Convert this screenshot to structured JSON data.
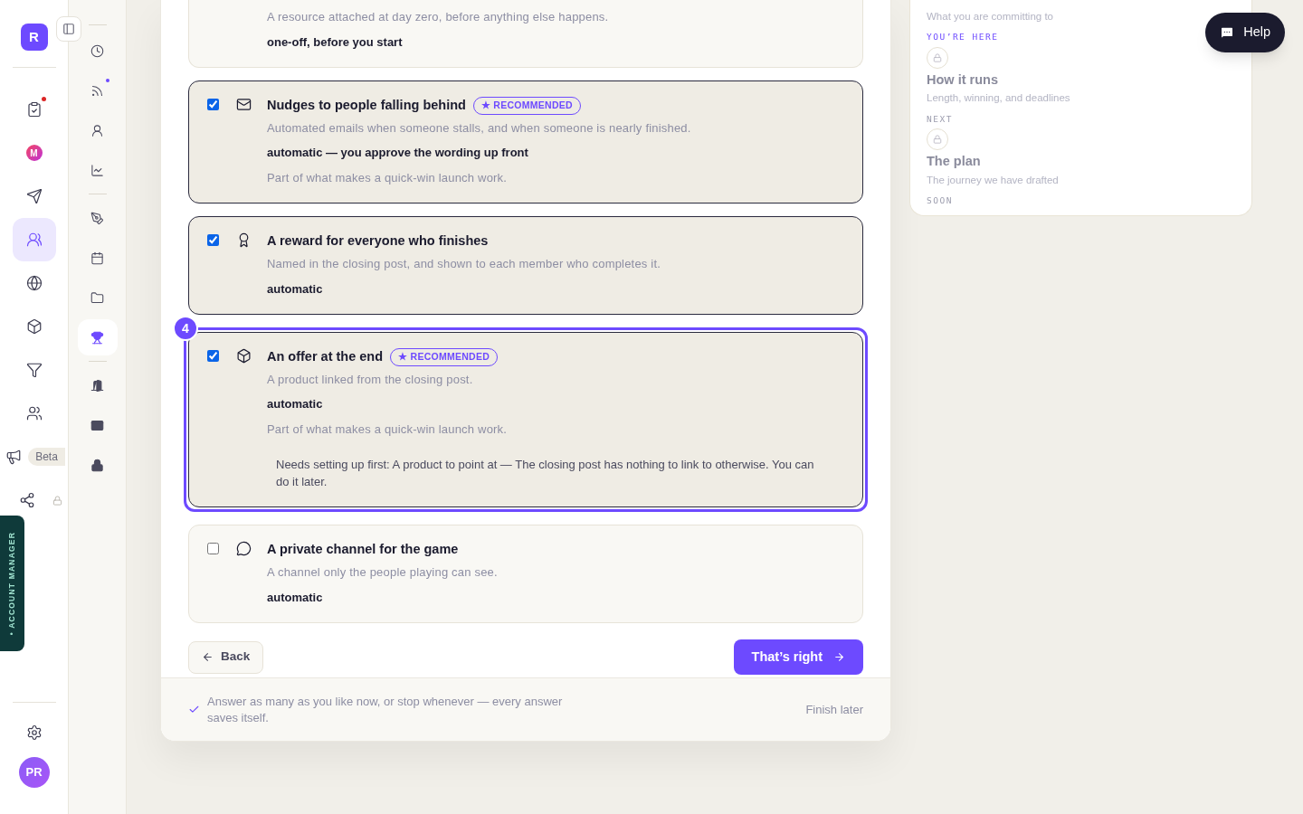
{
  "rail": {
    "logo": "R",
    "items": [
      {
        "selected": false,
        "dot": true
      },
      {
        "label": "M",
        "selected": false,
        "dot": false
      },
      {
        "selected": false,
        "dot": false
      },
      {
        "selected": true,
        "dot": false
      },
      {
        "selected": false,
        "dot": false
      },
      {
        "selected": false,
        "dot": false
      },
      {
        "selected": false,
        "dot": false
      },
      {
        "selected": false,
        "dot": false
      },
      {
        "badge": "Beta",
        "selected": false,
        "dot": false
      },
      {
        "locked": true,
        "selected": false,
        "dot": false
      }
    ],
    "account_manager": "• ACCOUNT MANAGER",
    "avatar": "PR"
  },
  "subrail": {
    "groups": [
      [
        {
          "selected": false,
          "dot": false
        },
        {
          "selected": false,
          "dot": true
        },
        {
          "selected": false,
          "dot": false
        },
        {
          "selected": false,
          "dot": false
        }
      ],
      [
        {
          "selected": false,
          "dot": false
        },
        {
          "selected": false,
          "dot": false
        },
        {
          "selected": false,
          "dot": false
        },
        {
          "selected": true,
          "dot": false
        }
      ],
      [
        {
          "selected": false,
          "dot": false
        },
        {
          "selected": false,
          "dot": false
        },
        {
          "selected": false,
          "dot": false
        }
      ]
    ]
  },
  "items": [
    {
      "checked": false,
      "highlighted": false,
      "description": "A resource attached at day zero, before anything else happens.",
      "timing": "one-off, before you start"
    },
    {
      "title": "Nudges to people falling behind",
      "checked": true,
      "recommended": true,
      "badge": "★ RECOMMENDED",
      "highlighted": false,
      "description": "Automated emails when someone stalls, and when someone is nearly finished.",
      "timing": "automatic — you approve the wording up front",
      "note": "Part of what makes a quick-win launch work."
    },
    {
      "title": "A reward for everyone who finishes",
      "checked": true,
      "recommended": false,
      "highlighted": false,
      "description": "Named in the closing post, and shown to each member who completes it.",
      "timing": "automatic"
    },
    {
      "title": "An offer at the end",
      "checked": true,
      "recommended": true,
      "badge": "★ RECOMMENDED",
      "highlighted": true,
      "step": "4",
      "description": "A product linked from the closing post.",
      "timing": "automatic",
      "note": "Part of what makes a quick-win launch work.",
      "setup": "Needs setting up first: A product to point at — The closing post has nothing to link to otherwise. You can do it later."
    },
    {
      "title": "A private channel for the game",
      "checked": false,
      "recommended": false,
      "highlighted": false,
      "description": "A channel only the people playing can see.",
      "timing": "automatic"
    }
  ],
  "actions": {
    "back": "Back",
    "next": "That’s right"
  },
  "footer": {
    "message": "Answer as many as you like now, or stop whenever — every answer saves itself.",
    "finish": "Finish later"
  },
  "steps": [
    {
      "subtitle": "What you are committing to",
      "status": "YOU’RE HERE",
      "current": true,
      "locked": false
    },
    {
      "title": "How it runs",
      "subtitle": "Length, winning, and deadlines",
      "status": "NEXT",
      "current": false,
      "locked": true
    },
    {
      "title": "The plan",
      "subtitle": "The journey we have drafted",
      "status": "SOON",
      "current": false,
      "locked": true
    }
  ],
  "help": "Help"
}
